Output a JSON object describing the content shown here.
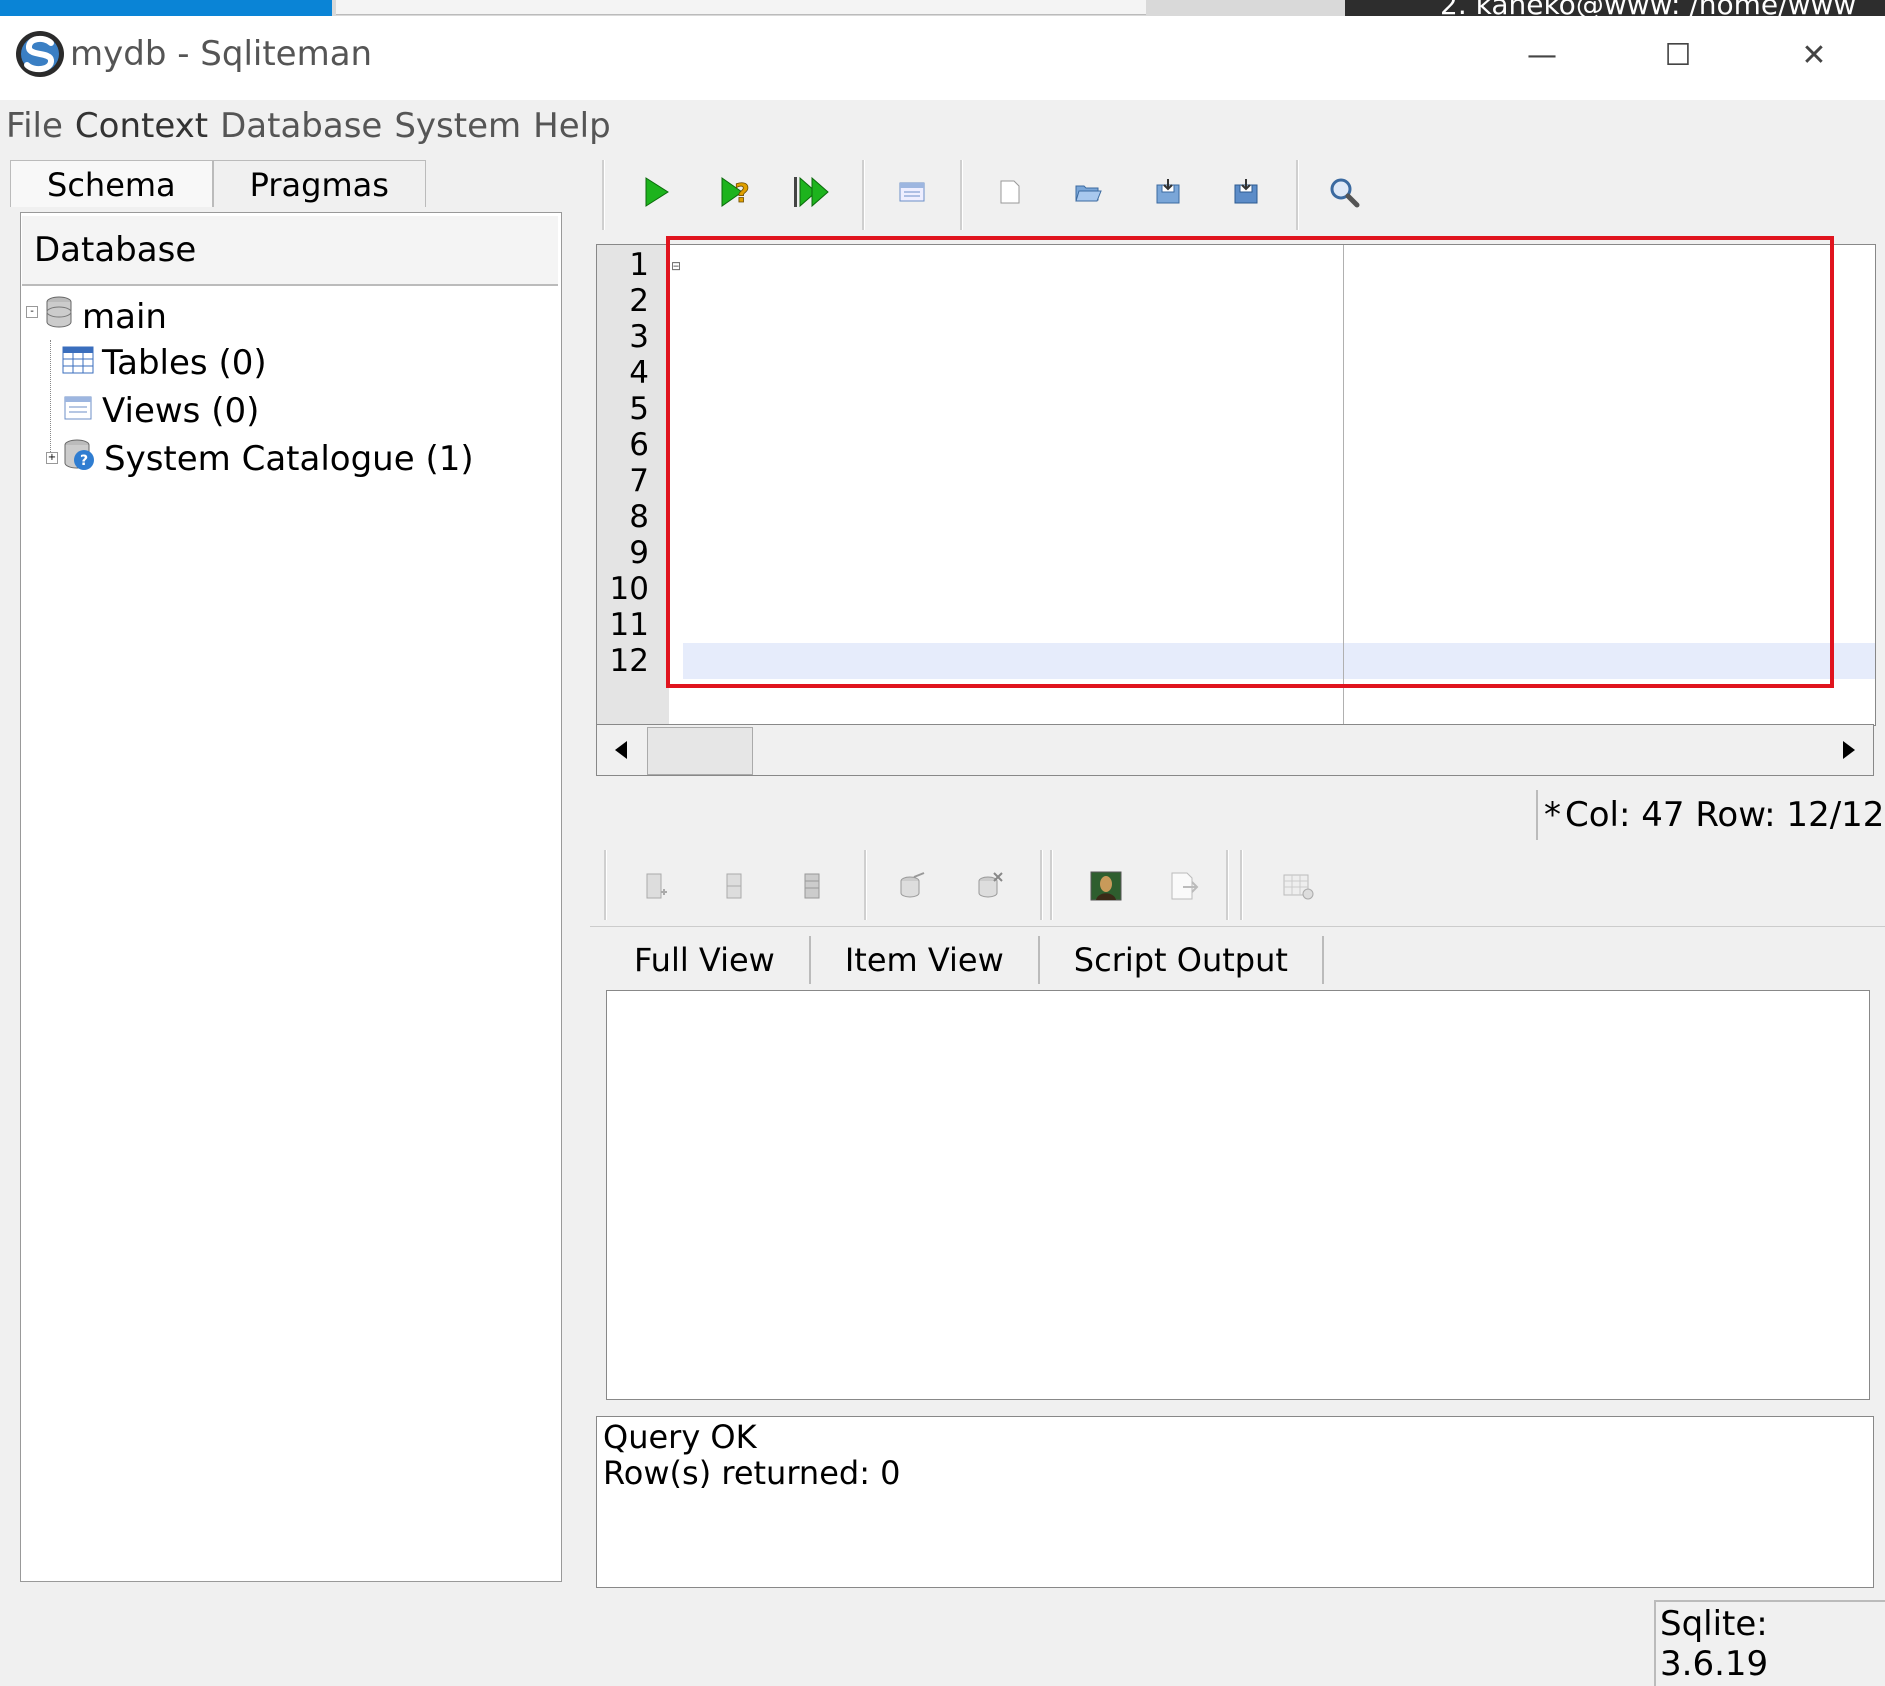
{
  "desktop_strip": {
    "terminal_title": "2. kaneko@www: /home/www"
  },
  "window": {
    "title": "mydb - Sqliteman",
    "minimize_glyph": "—",
    "maximize_glyph": "☐",
    "close_glyph": "✕"
  },
  "menu": [
    "File",
    "Context",
    "Database",
    "System",
    "Help"
  ],
  "left": {
    "tabs": [
      "Schema",
      "Pragmas"
    ],
    "tree_header": "Database",
    "tree": {
      "root": "main",
      "children": [
        "Tables (0)",
        "Views (0)",
        "System Catalogue (1)"
      ]
    }
  },
  "editor": {
    "line_numbers": [
      "1",
      "2",
      "3",
      "4",
      "5",
      "6",
      "7",
      "8",
      "9",
      "10",
      "11",
      "12"
    ],
    "current_line": 12,
    "fold_marker": "⊟"
  },
  "status": {
    "modified_mark": "*",
    "cursor": "Col: 47 Row: 12/12",
    "sqlite_version": "Sqlite: 3.6.19"
  },
  "results": {
    "tabs": [
      "Full View",
      "Item View",
      "Script Output"
    ],
    "messages": [
      "Query OK",
      "Row(s) returned: 0"
    ]
  },
  "icons": {
    "editor_toolbar": [
      "run-sql-icon",
      "explain-query-icon",
      "run-script-icon",
      "history-icon",
      "new-file-icon",
      "open-file-icon",
      "save-file-icon",
      "save-as-icon",
      "search-icon"
    ],
    "result_toolbar": [
      "insert-row-icon",
      "duplicate-row-icon",
      "remove-row-icon",
      "commit-icon",
      "rollback-icon",
      "blob-image-icon",
      "export-icon",
      "table-config-icon"
    ]
  },
  "colors": {
    "keyword": "#00007f",
    "number": "#007f7f",
    "highlight_border": "#e0141e",
    "current_line": "#e6ecfb"
  }
}
